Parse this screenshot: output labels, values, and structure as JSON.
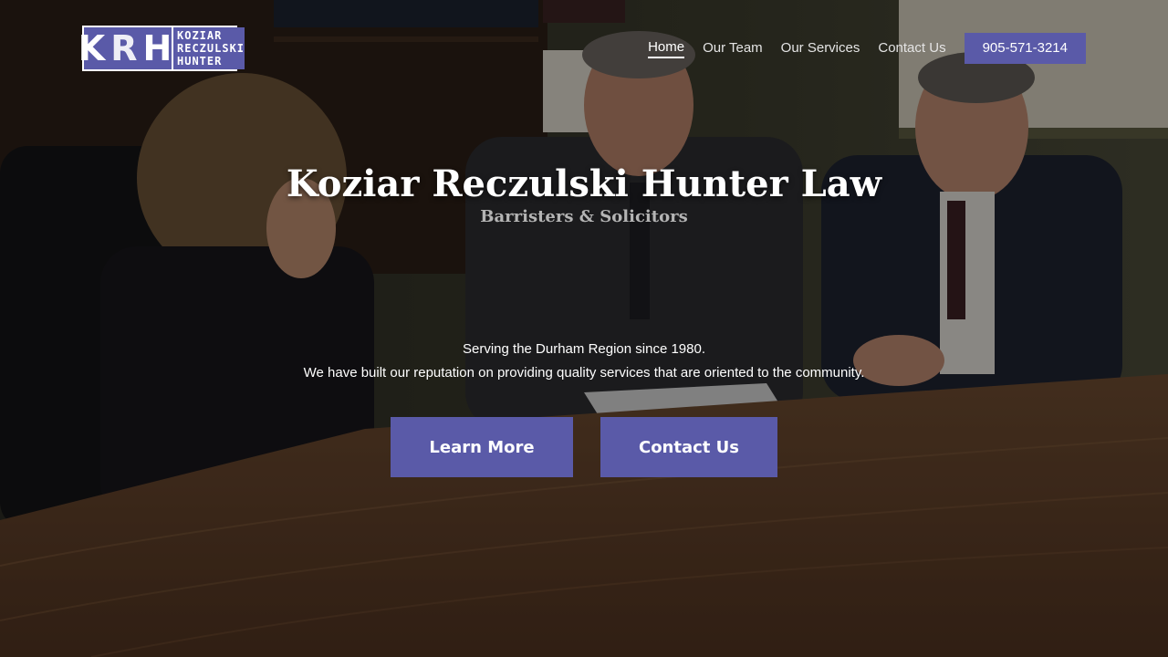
{
  "logo": {
    "letters": [
      "K",
      "R",
      "H"
    ],
    "lines": [
      "KOZIAR",
      "RECZULSKI",
      "HUNTER"
    ]
  },
  "nav": {
    "items": [
      {
        "label": "Home",
        "active": true
      },
      {
        "label": "Our Team",
        "active": false
      },
      {
        "label": "Our Services",
        "active": false
      },
      {
        "label": "Contact Us",
        "active": false
      }
    ],
    "phone": "905-571-3214"
  },
  "hero": {
    "title": "Koziar Reczulski Hunter Law",
    "subtitle": "Barristers & Solicitors",
    "line1": "Serving the Durham Region since 1980.",
    "line2": "We have built our reputation on providing quality services that are oriented to the community.",
    "learn_more": "Learn More",
    "contact_us": "Contact Us"
  },
  "colors": {
    "accent": "#5a5aa8",
    "text": "#ffffff",
    "subtitle": "#b4b4b4"
  }
}
